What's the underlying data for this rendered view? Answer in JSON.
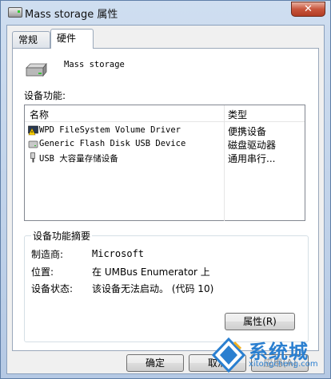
{
  "window": {
    "title": "Mass storage 属性",
    "close_glyph": "✕"
  },
  "tabs": [
    {
      "label": "常规",
      "active": false
    },
    {
      "label": "硬件",
      "active": true
    }
  ],
  "device": {
    "name": "Mass storage",
    "icon": "drive-icon"
  },
  "functions": {
    "label": "设备功能:",
    "columns": {
      "name": "名称",
      "type": "类型"
    },
    "rows": [
      {
        "name": "WPD FileSystem Volume Driver",
        "type": "便携设备",
        "icon": "wpd-warning-icon"
      },
      {
        "name": "Generic Flash Disk USB Device",
        "type": "磁盘驱动器",
        "icon": "disk-drive-icon"
      },
      {
        "name": "USB 大容量存储设备",
        "type": "通用串行...",
        "icon": "usb-icon"
      }
    ]
  },
  "summary": {
    "title": "设备功能摘要",
    "manufacturer_label": "制造商:",
    "manufacturer_value": "Microsoft",
    "location_label": "位置:",
    "location_value": "在 UMBus Enumerator 上",
    "status_label": "设备状态:",
    "status_value": "该设备无法启动。 (代码 10)",
    "properties_button": "属性(R)"
  },
  "buttons": {
    "ok": "确定",
    "cancel": "取消",
    "apply": "应用(A)"
  },
  "watermark": {
    "text_cn": "系统城",
    "text_en": "xitongcheng.com"
  },
  "colors": {
    "accent": "#2a7fd0",
    "close": "#c8553c"
  }
}
